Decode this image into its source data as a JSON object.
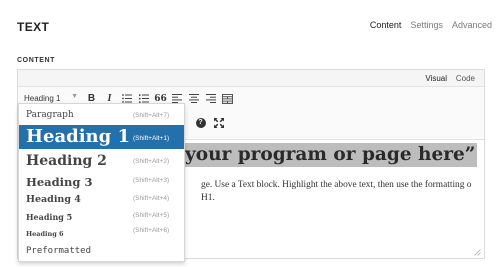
{
  "panel": {
    "title": "TEXT",
    "tabs": [
      {
        "label": "Content",
        "active": true
      },
      {
        "label": "Settings",
        "active": false
      },
      {
        "label": "Advanced",
        "active": false
      }
    ]
  },
  "section_label": "CONTENT",
  "editor": {
    "modes": {
      "visual": "Visual",
      "code": "Code"
    },
    "format_select": {
      "value": "Heading 1"
    },
    "toolbar_icons": [
      "bold-icon",
      "italic-icon",
      "bulleted-list-icon",
      "numbered-list-icon",
      "blockquote-icon",
      "align-left-icon",
      "align-center-icon",
      "align-right-icon",
      "toolbar-toggle-icon",
      "help-icon",
      "fullscreen-icon"
    ],
    "toolbar_glyphs": {
      "bold": "B",
      "italic": "I",
      "blockquote": "66",
      "help": "?"
    },
    "content": {
      "heading_text": "your program or page here”",
      "body_text": "ge. Use a Text block. Highlight the above text, then use the formatting o H1."
    }
  },
  "format_dropdown": {
    "selected": "Heading 1",
    "items": [
      {
        "label": "Paragraph",
        "shortcut": "(Shift+Alt+7)"
      },
      {
        "label": "Heading 1",
        "shortcut": "(Shift+Alt+1)"
      },
      {
        "label": "Heading 2",
        "shortcut": "(Shift+Alt+2)"
      },
      {
        "label": "Heading 3",
        "shortcut": "(Shift+Alt+3)"
      },
      {
        "label": "Heading 4",
        "shortcut": "(Shift+Alt+4)"
      },
      {
        "label": "Heading 5",
        "shortcut": "(Shift+Alt+5)"
      },
      {
        "label": "Heading 6",
        "shortcut": "(Shift+Alt+6)"
      },
      {
        "label": "Preformatted",
        "shortcut": ""
      }
    ]
  },
  "colors": {
    "selected_item_bg": "#2470aa",
    "highlight_bg": "#bdbdbd"
  }
}
